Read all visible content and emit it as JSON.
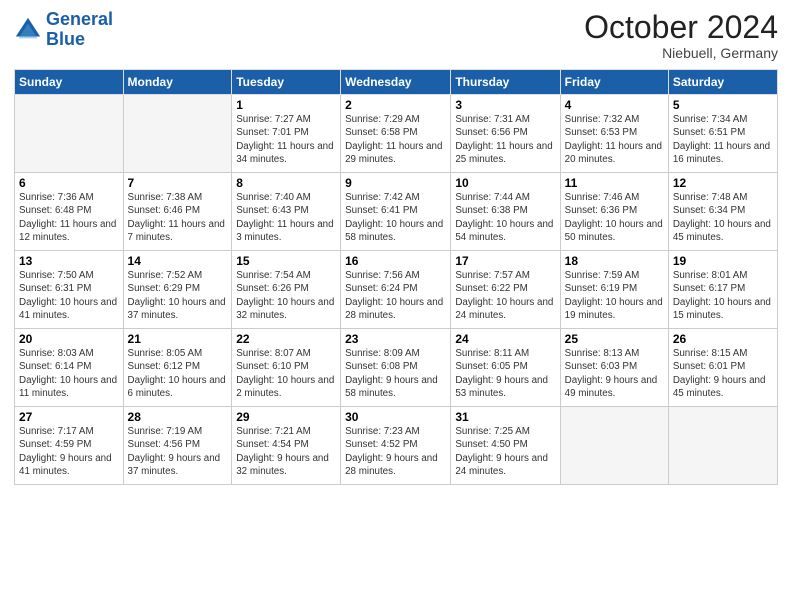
{
  "header": {
    "logo_line1": "General",
    "logo_line2": "Blue",
    "month": "October 2024",
    "location": "Niebuell, Germany"
  },
  "days_of_week": [
    "Sunday",
    "Monday",
    "Tuesday",
    "Wednesday",
    "Thursday",
    "Friday",
    "Saturday"
  ],
  "weeks": [
    [
      {
        "day": "",
        "sunrise": "",
        "sunset": "",
        "daylight": "",
        "empty": true
      },
      {
        "day": "",
        "sunrise": "",
        "sunset": "",
        "daylight": "",
        "empty": true
      },
      {
        "day": "1",
        "sunrise": "Sunrise: 7:27 AM",
        "sunset": "Sunset: 7:01 PM",
        "daylight": "Daylight: 11 hours and 34 minutes.",
        "empty": false
      },
      {
        "day": "2",
        "sunrise": "Sunrise: 7:29 AM",
        "sunset": "Sunset: 6:58 PM",
        "daylight": "Daylight: 11 hours and 29 minutes.",
        "empty": false
      },
      {
        "day": "3",
        "sunrise": "Sunrise: 7:31 AM",
        "sunset": "Sunset: 6:56 PM",
        "daylight": "Daylight: 11 hours and 25 minutes.",
        "empty": false
      },
      {
        "day": "4",
        "sunrise": "Sunrise: 7:32 AM",
        "sunset": "Sunset: 6:53 PM",
        "daylight": "Daylight: 11 hours and 20 minutes.",
        "empty": false
      },
      {
        "day": "5",
        "sunrise": "Sunrise: 7:34 AM",
        "sunset": "Sunset: 6:51 PM",
        "daylight": "Daylight: 11 hours and 16 minutes.",
        "empty": false
      }
    ],
    [
      {
        "day": "6",
        "sunrise": "Sunrise: 7:36 AM",
        "sunset": "Sunset: 6:48 PM",
        "daylight": "Daylight: 11 hours and 12 minutes.",
        "empty": false
      },
      {
        "day": "7",
        "sunrise": "Sunrise: 7:38 AM",
        "sunset": "Sunset: 6:46 PM",
        "daylight": "Daylight: 11 hours and 7 minutes.",
        "empty": false
      },
      {
        "day": "8",
        "sunrise": "Sunrise: 7:40 AM",
        "sunset": "Sunset: 6:43 PM",
        "daylight": "Daylight: 11 hours and 3 minutes.",
        "empty": false
      },
      {
        "day": "9",
        "sunrise": "Sunrise: 7:42 AM",
        "sunset": "Sunset: 6:41 PM",
        "daylight": "Daylight: 10 hours and 58 minutes.",
        "empty": false
      },
      {
        "day": "10",
        "sunrise": "Sunrise: 7:44 AM",
        "sunset": "Sunset: 6:38 PM",
        "daylight": "Daylight: 10 hours and 54 minutes.",
        "empty": false
      },
      {
        "day": "11",
        "sunrise": "Sunrise: 7:46 AM",
        "sunset": "Sunset: 6:36 PM",
        "daylight": "Daylight: 10 hours and 50 minutes.",
        "empty": false
      },
      {
        "day": "12",
        "sunrise": "Sunrise: 7:48 AM",
        "sunset": "Sunset: 6:34 PM",
        "daylight": "Daylight: 10 hours and 45 minutes.",
        "empty": false
      }
    ],
    [
      {
        "day": "13",
        "sunrise": "Sunrise: 7:50 AM",
        "sunset": "Sunset: 6:31 PM",
        "daylight": "Daylight: 10 hours and 41 minutes.",
        "empty": false
      },
      {
        "day": "14",
        "sunrise": "Sunrise: 7:52 AM",
        "sunset": "Sunset: 6:29 PM",
        "daylight": "Daylight: 10 hours and 37 minutes.",
        "empty": false
      },
      {
        "day": "15",
        "sunrise": "Sunrise: 7:54 AM",
        "sunset": "Sunset: 6:26 PM",
        "daylight": "Daylight: 10 hours and 32 minutes.",
        "empty": false
      },
      {
        "day": "16",
        "sunrise": "Sunrise: 7:56 AM",
        "sunset": "Sunset: 6:24 PM",
        "daylight": "Daylight: 10 hours and 28 minutes.",
        "empty": false
      },
      {
        "day": "17",
        "sunrise": "Sunrise: 7:57 AM",
        "sunset": "Sunset: 6:22 PM",
        "daylight": "Daylight: 10 hours and 24 minutes.",
        "empty": false
      },
      {
        "day": "18",
        "sunrise": "Sunrise: 7:59 AM",
        "sunset": "Sunset: 6:19 PM",
        "daylight": "Daylight: 10 hours and 19 minutes.",
        "empty": false
      },
      {
        "day": "19",
        "sunrise": "Sunrise: 8:01 AM",
        "sunset": "Sunset: 6:17 PM",
        "daylight": "Daylight: 10 hours and 15 minutes.",
        "empty": false
      }
    ],
    [
      {
        "day": "20",
        "sunrise": "Sunrise: 8:03 AM",
        "sunset": "Sunset: 6:14 PM",
        "daylight": "Daylight: 10 hours and 11 minutes.",
        "empty": false
      },
      {
        "day": "21",
        "sunrise": "Sunrise: 8:05 AM",
        "sunset": "Sunset: 6:12 PM",
        "daylight": "Daylight: 10 hours and 6 minutes.",
        "empty": false
      },
      {
        "day": "22",
        "sunrise": "Sunrise: 8:07 AM",
        "sunset": "Sunset: 6:10 PM",
        "daylight": "Daylight: 10 hours and 2 minutes.",
        "empty": false
      },
      {
        "day": "23",
        "sunrise": "Sunrise: 8:09 AM",
        "sunset": "Sunset: 6:08 PM",
        "daylight": "Daylight: 9 hours and 58 minutes.",
        "empty": false
      },
      {
        "day": "24",
        "sunrise": "Sunrise: 8:11 AM",
        "sunset": "Sunset: 6:05 PM",
        "daylight": "Daylight: 9 hours and 53 minutes.",
        "empty": false
      },
      {
        "day": "25",
        "sunrise": "Sunrise: 8:13 AM",
        "sunset": "Sunset: 6:03 PM",
        "daylight": "Daylight: 9 hours and 49 minutes.",
        "empty": false
      },
      {
        "day": "26",
        "sunrise": "Sunrise: 8:15 AM",
        "sunset": "Sunset: 6:01 PM",
        "daylight": "Daylight: 9 hours and 45 minutes.",
        "empty": false
      }
    ],
    [
      {
        "day": "27",
        "sunrise": "Sunrise: 7:17 AM",
        "sunset": "Sunset: 4:59 PM",
        "daylight": "Daylight: 9 hours and 41 minutes.",
        "empty": false
      },
      {
        "day": "28",
        "sunrise": "Sunrise: 7:19 AM",
        "sunset": "Sunset: 4:56 PM",
        "daylight": "Daylight: 9 hours and 37 minutes.",
        "empty": false
      },
      {
        "day": "29",
        "sunrise": "Sunrise: 7:21 AM",
        "sunset": "Sunset: 4:54 PM",
        "daylight": "Daylight: 9 hours and 32 minutes.",
        "empty": false
      },
      {
        "day": "30",
        "sunrise": "Sunrise: 7:23 AM",
        "sunset": "Sunset: 4:52 PM",
        "daylight": "Daylight: 9 hours and 28 minutes.",
        "empty": false
      },
      {
        "day": "31",
        "sunrise": "Sunrise: 7:25 AM",
        "sunset": "Sunset: 4:50 PM",
        "daylight": "Daylight: 9 hours and 24 minutes.",
        "empty": false
      },
      {
        "day": "",
        "sunrise": "",
        "sunset": "",
        "daylight": "",
        "empty": true
      },
      {
        "day": "",
        "sunrise": "",
        "sunset": "",
        "daylight": "",
        "empty": true
      }
    ]
  ]
}
